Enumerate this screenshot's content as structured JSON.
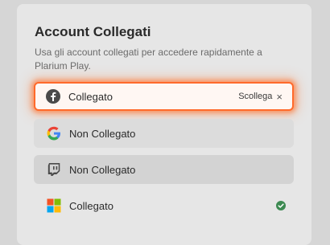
{
  "panel": {
    "title": "Account Collegati",
    "subtitle": "Usa gli account collegati per accedere rapidamente a Plarium Play."
  },
  "accounts": [
    {
      "provider_icon": "facebook-icon",
      "status": "Collegato",
      "action": "Scollega",
      "action_icon": "×"
    },
    {
      "provider_icon": "google-icon",
      "status": "Non Collegato"
    },
    {
      "provider_icon": "twitch-icon",
      "status": "Non Collegato"
    },
    {
      "provider_icon": "microsoft-icon",
      "status": "Collegato",
      "badge": "check-icon"
    }
  ],
  "colors": {
    "highlight": "#ff6a2b",
    "check": "#3d8a52"
  }
}
